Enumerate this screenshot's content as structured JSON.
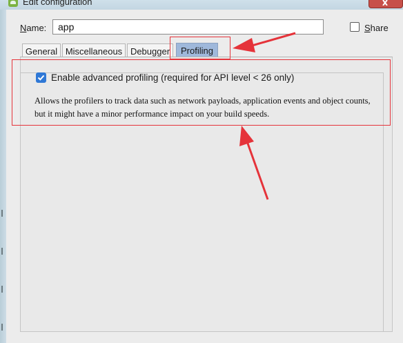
{
  "window": {
    "title": "Edit configuration",
    "icon": "android-studio-icon",
    "close_icon": "close-icon"
  },
  "name_field": {
    "label_accel": "N",
    "label_rest": "ame:",
    "value": "app"
  },
  "share": {
    "label_accel": "S",
    "label_rest": "hare",
    "checked": false
  },
  "tabs": [
    {
      "label": "General",
      "active": false
    },
    {
      "label": "Miscellaneous",
      "active": false
    },
    {
      "label": "Debugger",
      "active": false
    },
    {
      "label": "Profiling",
      "active": true
    }
  ],
  "profiling": {
    "enable_label": "Enable advanced profiling (required for API level < 26 only)",
    "enable_checked": true,
    "description_line1": "Allows the profilers to track data such as network payloads, application events and object counts,",
    "description_line2": "but it might have a minor performance impact on your build speeds."
  },
  "annotations": {
    "color": "#e5333a"
  }
}
